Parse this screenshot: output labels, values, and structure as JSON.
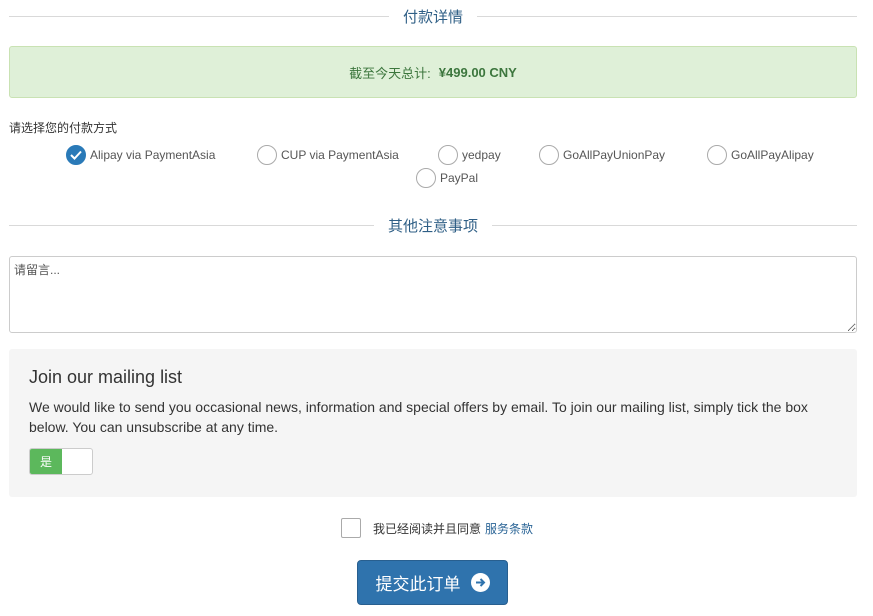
{
  "payment_details": {
    "title": "付款详情",
    "total_label": "截至今天总计:",
    "total_amount": "¥499.00 CNY"
  },
  "payment_method": {
    "label": "请选择您的付款方式",
    "selected": "Alipay via PaymentAsia",
    "options": [
      {
        "label": "Alipay via PaymentAsia",
        "checked": true
      },
      {
        "label": "CUP via PaymentAsia",
        "checked": false
      },
      {
        "label": "yedpay",
        "checked": false
      },
      {
        "label": "GoAllPayUnionPay",
        "checked": false
      },
      {
        "label": "GoAllPayAlipay",
        "checked": false
      },
      {
        "label": "PayPal",
        "checked": false
      }
    ]
  },
  "notes": {
    "title": "其他注意事项",
    "placeholder": "请留言..."
  },
  "mailing_list": {
    "title": "Join our mailing list",
    "description": "We would like to send you occasional news, information and special offers by email. To join our mailing list, simply tick the box below. You can unsubscribe at any time.",
    "toggle_label": "是"
  },
  "terms": {
    "text": "我已经阅读并且同意",
    "link": "服务条款"
  },
  "submit": {
    "label": "提交此订单"
  },
  "colors": {
    "accent": "#2a7ab8",
    "success_bg": "#dff0d8",
    "toggle_on": "#5cb85c",
    "button": "#2f73ad"
  }
}
